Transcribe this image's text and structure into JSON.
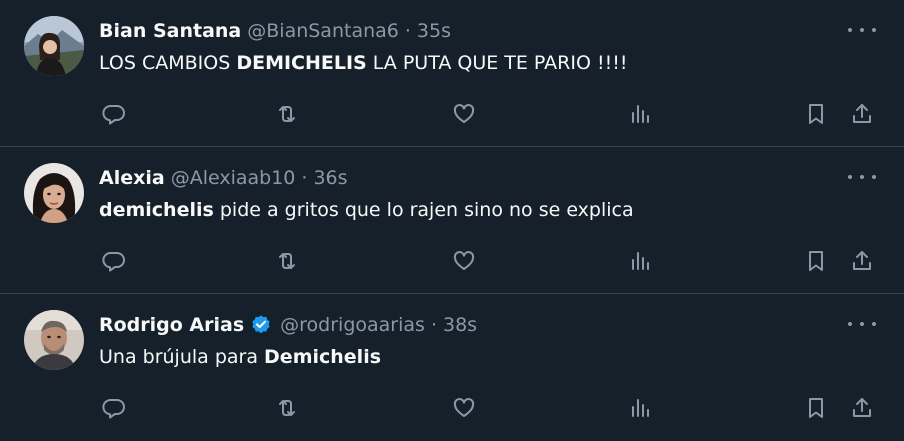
{
  "colors": {
    "background": "#15202b",
    "text_primary": "#f7f9f9",
    "text_secondary": "#8b98a5",
    "verified_blue": "#1d9bf0",
    "divider": "#38444d"
  },
  "tweets": [
    {
      "name": "Bian Santana",
      "handle": "@BianSantana6",
      "separator": "·",
      "time": "35s",
      "verified": false,
      "text_parts": [
        {
          "text": "LOS CAMBIOS ",
          "bold": false
        },
        {
          "text": "DEMICHELIS",
          "bold": true
        },
        {
          "text": " LA PUTA QUE TE PARIO !!!!",
          "bold": false
        }
      ]
    },
    {
      "name": "Alexia",
      "handle": "@Alexiaab10",
      "separator": "·",
      "time": "36s",
      "verified": false,
      "text_parts": [
        {
          "text": "demichelis",
          "bold": true
        },
        {
          "text": " pide a gritos que lo rajen sino no se explica",
          "bold": false
        }
      ]
    },
    {
      "name": "Rodrigo Arias",
      "handle": "@rodrigoaarias",
      "separator": "·",
      "time": "38s",
      "verified": true,
      "text_parts": [
        {
          "text": "Una brújula para ",
          "bold": false
        },
        {
          "text": "Demichelis",
          "bold": true
        }
      ]
    }
  ],
  "icons": {
    "more": "more-horizontal-icon",
    "reply": "reply-icon",
    "retweet": "retweet-icon",
    "like": "heart-icon",
    "views": "views-chart-icon",
    "bookmark": "bookmark-icon",
    "share": "share-icon",
    "verified": "verified-badge-icon"
  }
}
